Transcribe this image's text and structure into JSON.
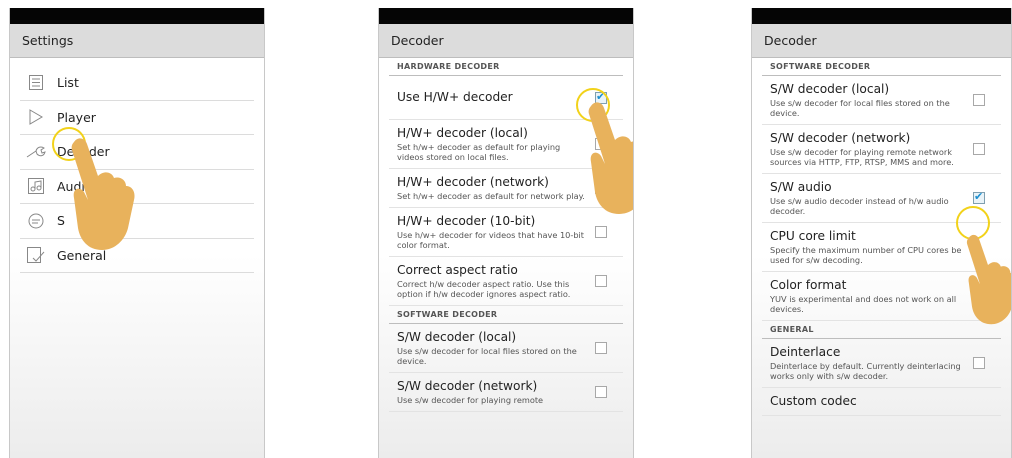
{
  "screens": [
    {
      "title": "Settings",
      "menu": [
        {
          "label": "List",
          "icon": "list-icon"
        },
        {
          "label": "Player",
          "icon": "play-icon"
        },
        {
          "label": "Decoder",
          "icon": "wrench-icon"
        },
        {
          "label": "Audio",
          "icon": "music-icon"
        },
        {
          "label": "S",
          "icon": "subtitle-icon"
        },
        {
          "label": "General",
          "icon": "general-icon"
        }
      ]
    },
    {
      "title": "Decoder",
      "sections": [
        {
          "header": "HARDWARE DECODER"
        },
        {
          "header": "SOFTWARE DECODER"
        }
      ],
      "prefs": [
        {
          "title": "Use H/W+ decoder",
          "summary": "",
          "checked": true
        },
        {
          "title": "H/W+ decoder (local)",
          "summary": "Set h/w+ decoder as default for playing videos stored on local files.",
          "checked": false
        },
        {
          "title": "H/W+ decoder (network)",
          "summary": "Set h/w+ decoder as default for network play.",
          "checked": false
        },
        {
          "title": "H/W+ decoder (10-bit)",
          "summary": "Use h/w+ decoder for videos that have 10-bit color format.",
          "checked": false
        },
        {
          "title": "Correct aspect ratio",
          "summary": "Correct h/w decoder aspect ratio. Use this option if h/w decoder ignores aspect ratio.",
          "checked": false
        },
        {
          "title": "S/W decoder (local)",
          "summary": "Use s/w decoder for local files stored on the device.",
          "checked": false
        },
        {
          "title": "S/W decoder (network)",
          "summary": "Use s/w decoder for playing remote",
          "checked": false
        }
      ]
    },
    {
      "title": "Decoder",
      "sections": [
        {
          "header": "SOFTWARE DECODER"
        },
        {
          "header": "GENERAL"
        }
      ],
      "prefs": [
        {
          "title": "S/W decoder (local)",
          "summary": "Use s/w decoder for local files stored on the device.",
          "checked": false
        },
        {
          "title": "S/W decoder (network)",
          "summary": "Use s/w decoder for playing remote network sources via HTTP, FTP, RTSP, MMS and more.",
          "checked": false
        },
        {
          "title": "S/W audio",
          "summary": "Use s/w audio decoder instead of h/w audio decoder.",
          "checked": true
        },
        {
          "title": "CPU core limit",
          "summary": "Specify the maximum number of CPU cores be used for s/w decoding."
        },
        {
          "title": "Color format",
          "summary": "YUV is experimental and does not work on all devices."
        },
        {
          "title": "Deinterlace",
          "summary": "Deinterlace by default. Currently deinterlacing works only with s/w decoder.",
          "checked": false
        },
        {
          "title": "Custom codec",
          "summary": ""
        }
      ]
    }
  ],
  "colors": {
    "accent": "#1c8fd0",
    "highlight_ring": "#f2d21a",
    "hand": "#e8b25c"
  }
}
